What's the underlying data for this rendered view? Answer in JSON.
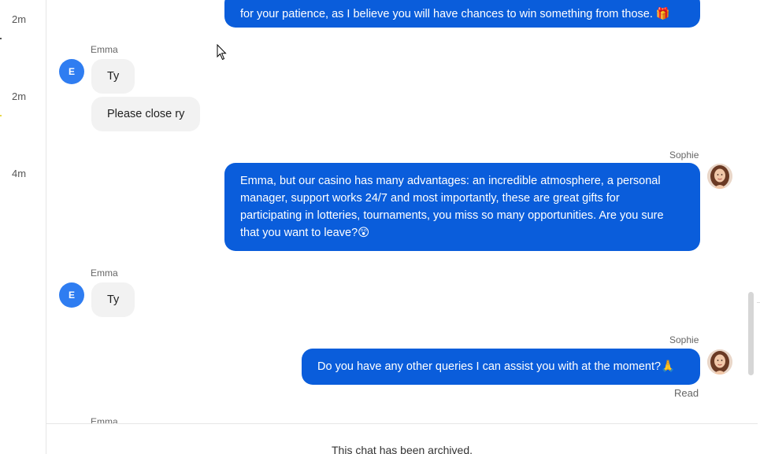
{
  "timestamps": [
    "2m",
    "2m",
    "4m"
  ],
  "messages": {
    "m0": {
      "text": "for your patience, as I believe you will have chances to win something from those. 🎁"
    },
    "m1": {
      "sender": "Emma",
      "avatar_letter": "E",
      "bubbles": [
        "Ty",
        "Please close ry"
      ]
    },
    "m2": {
      "sender": "Sophie",
      "lines": [
        "Emma, but our casino has many advantages: an incredible atmosphere, a personal",
        "manager, support works 24/7 and most importantly, these are great gifts for",
        "participating in lotteries, tournaments, you miss so many opportunities. Are you sure",
        "that you want to leave?😲"
      ]
    },
    "m3": {
      "sender": "Emma",
      "avatar_letter": "E",
      "text": "Ty"
    },
    "m4": {
      "sender": "Sophie",
      "text": "Do you have any other queries I can assist you with at the moment?🙏",
      "status": "Read"
    },
    "m5": {
      "sender": "Emma"
    }
  },
  "footer": {
    "text": "This chat has been archived."
  },
  "colors": {
    "outgoing_bubble": "#0a5ddb",
    "incoming_bubble": "#f2f2f2",
    "avatar_letter_bg": "#2f7df1"
  }
}
